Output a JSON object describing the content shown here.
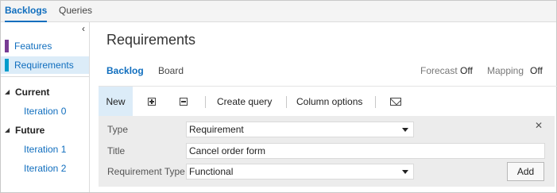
{
  "top_tabs": [
    {
      "label": "Backlogs"
    },
    {
      "label": "Queries"
    }
  ],
  "sidebar": {
    "collapse_icon": "chevron-left-icon",
    "backlogs": [
      {
        "label": "Features",
        "color": "#773b93"
      },
      {
        "label": "Requirements",
        "color": "#009ccc"
      }
    ],
    "groups": [
      {
        "label": "Current",
        "iterations": [
          "Iteration 0"
        ]
      },
      {
        "label": "Future",
        "iterations": [
          "Iteration 1",
          "Iteration 2"
        ]
      }
    ]
  },
  "main": {
    "title": "Requirements",
    "subtabs": [
      {
        "label": "Backlog"
      },
      {
        "label": "Board"
      }
    ],
    "options": {
      "forecast_label": "Forecast",
      "forecast_value": "Off",
      "mapping_label": "Mapping",
      "mapping_value": "Off"
    },
    "toolbar": {
      "new_label": "New",
      "expand_icon": "expand-all-icon",
      "collapse_icon": "collapse-all-icon",
      "create_query_label": "Create query",
      "column_options_label": "Column options",
      "email_icon": "mail-icon"
    },
    "form": {
      "type_label": "Type",
      "type_value": "Requirement",
      "title_label": "Title",
      "title_value": "Cancel order form",
      "req_type_label": "Requirement Type",
      "req_type_value": "Functional",
      "close_icon": "close-icon",
      "close_glyph": "✕",
      "add_label": "Add"
    }
  },
  "colors": {
    "accent": "#106ebe",
    "selected_bg": "#dcecf8",
    "panel_bg": "#ececec"
  }
}
